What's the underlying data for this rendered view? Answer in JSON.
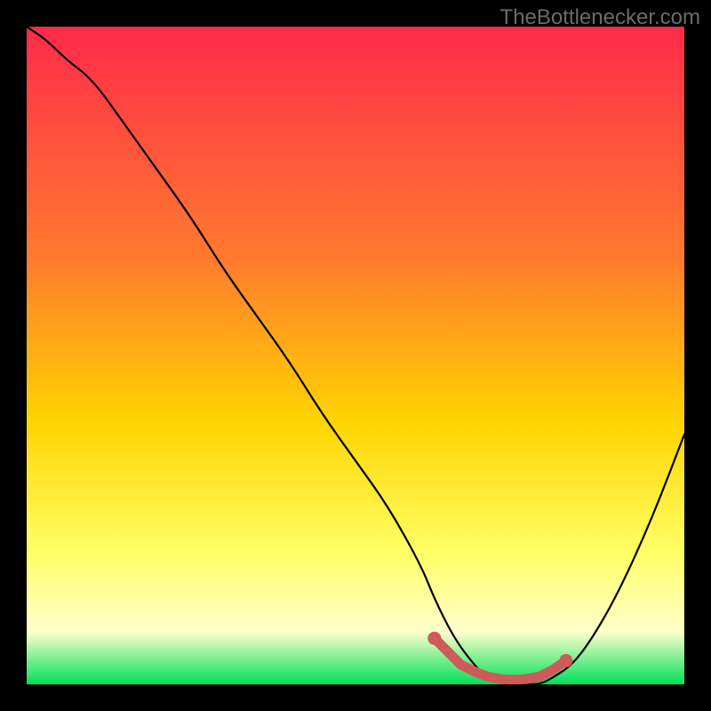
{
  "watermark": "TheBottlenecker.com",
  "colors": {
    "frame": "#000000",
    "gradient_top": "#ff2a4a",
    "gradient_mid1": "#ff7a2f",
    "gradient_mid2": "#ffd400",
    "gradient_mid3": "#ffff66",
    "gradient_mid4": "#ffffcc",
    "gradient_bottom": "#00e05a",
    "curve": "#000000",
    "marker": "#cf5a5a"
  },
  "chart_data": {
    "type": "line",
    "title": "",
    "xlabel": "",
    "ylabel": "",
    "xlim": [
      0,
      100
    ],
    "ylim": [
      0,
      100
    ],
    "series": [
      {
        "name": "bottleneck-curve",
        "x": [
          0,
          3,
          6,
          10,
          15,
          20,
          25,
          30,
          35,
          40,
          45,
          50,
          55,
          60,
          62,
          65,
          68,
          70,
          73,
          75,
          78,
          80,
          83,
          86,
          90,
          95,
          100
        ],
        "y": [
          100,
          98,
          95,
          92,
          85,
          78,
          71,
          63,
          56,
          49,
          41,
          34,
          27,
          18,
          13,
          7,
          3,
          1,
          0,
          0,
          0,
          1,
          3,
          7,
          14,
          25,
          38
        ]
      }
    ],
    "markers": {
      "name": "optimal-range",
      "x": [
        62,
        64,
        66,
        68,
        70,
        72,
        74,
        76,
        78,
        80,
        82
      ],
      "y": [
        7,
        5,
        3,
        2,
        1.2,
        0.8,
        0.7,
        0.8,
        1.2,
        2.2,
        3.6
      ]
    }
  }
}
